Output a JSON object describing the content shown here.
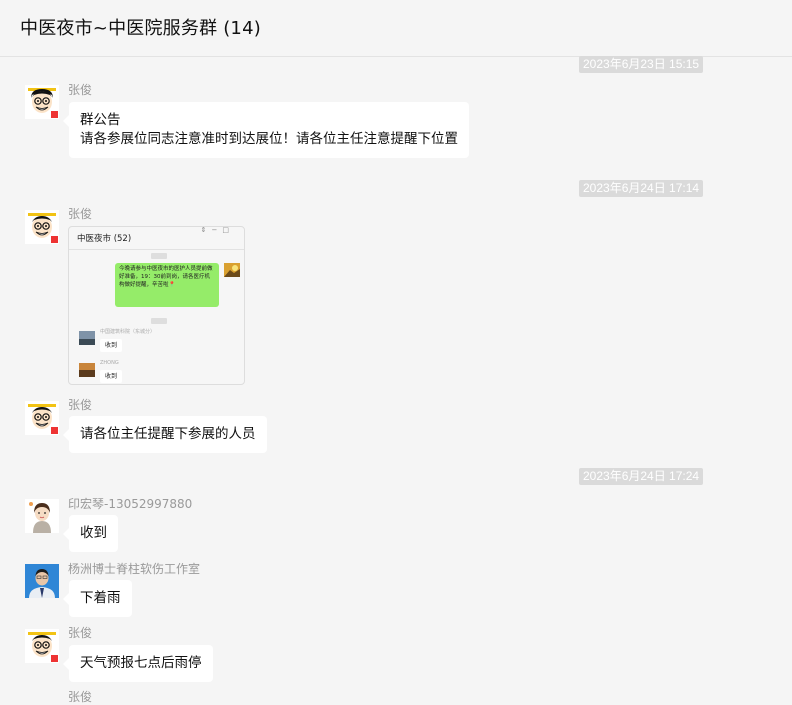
{
  "header": {
    "title": "中医夜市~中医院服务群 (14)"
  },
  "messages": [
    {
      "time": "2023年6月23日 15:15",
      "sender": "张俊",
      "text_line1": "群公告",
      "text_line2": "请各参展位同志注意准时到达展位！请各位主任注意提醒下位置"
    },
    {
      "time": "2023年6月24日 17:14",
      "sender": "张俊",
      "image": {
        "title": "中医夜市 (52)",
        "message": "今晚请参与中医夜市的医护人员提前做好准备，19：30前到岗，请各医疗机构做好提醒，辛苦啦📍",
        "reply_names": [
          "中国建筑科院（东城分）",
          "ZHONG"
        ],
        "reply_text": "收到"
      }
    },
    {
      "sender": "张俊",
      "text": "请各位主任提醒下参展的人员"
    },
    {
      "time": "2023年6月24日 17:24",
      "sender": "印宏琴-13052997880",
      "text": "收到"
    },
    {
      "sender": "杨洲博士脊柱软伤工作室",
      "text": "下着雨"
    },
    {
      "sender": "张俊",
      "text": "天气预报七点后雨停"
    },
    {
      "sender": "张俊"
    }
  ],
  "colors": {
    "timestamp_bg": "#dadada",
    "bubble_bg": "#ffffff",
    "page_bg": "#f5f5f5",
    "sender_text": "#9a9a9a",
    "green_bubble": "#95ec69"
  }
}
